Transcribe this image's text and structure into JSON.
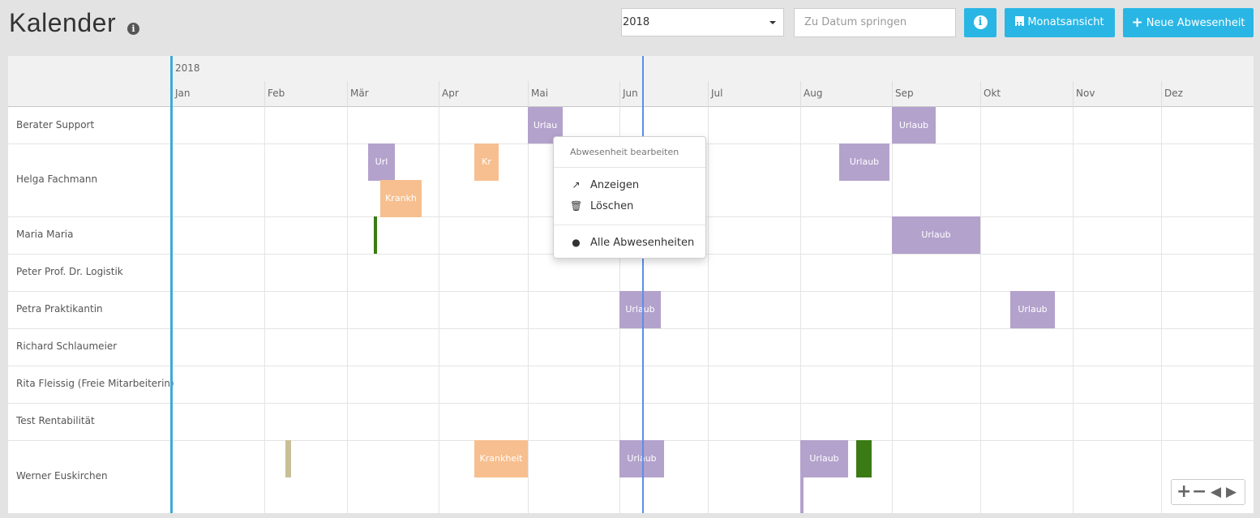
{
  "header": {
    "title": "Kalender",
    "year_select": "2018",
    "date_placeholder": "Zu Datum springen",
    "month_view_label": "Monatsansicht",
    "new_absence_label": "Neue Abwesenheit"
  },
  "calendar": {
    "year": "2018",
    "months": [
      "Jan",
      "Feb",
      "Mär",
      "Apr",
      "Mai",
      "Jun",
      "Jul",
      "Aug",
      "Sep",
      "Okt",
      "Nov",
      "Dez"
    ],
    "rows": [
      "Berater Support",
      "Helga Fachmann",
      "Maria Maria",
      "Peter Prof. Dr. Logistik",
      "Petra Praktikantin",
      "Richard Schlaumeier",
      "Rita Fleissig (Freie Mitarbeiterin)",
      "Test Rentabilität",
      "Werner Euskirchen"
    ],
    "events": [
      {
        "label": "Urlau"
      },
      {
        "label": "Urlaub"
      },
      {
        "label": "Url"
      },
      {
        "label": "Kr"
      },
      {
        "label": "Krankh"
      },
      {
        "label": "Urlaub"
      },
      {
        "label": "Urlaub"
      },
      {
        "label": "Urlaub"
      },
      {
        "label": "Urlaub"
      },
      {
        "label": "Krankheit"
      },
      {
        "label": "Urlaub"
      },
      {
        "label": "Urlaub"
      }
    ]
  },
  "context_menu": {
    "header": "Abwesenheit bearbeiten",
    "show": "Anzeigen",
    "delete": "Löschen",
    "all_absences": "Alle Abwesenheiten"
  },
  "zoom": {
    "zoom_in": "+",
    "zoom_out": "−",
    "prev": "◀",
    "next": "▶"
  },
  "colors": {
    "accent": "#29b6e5",
    "vacation": "#b3a2cc",
    "sickness": "#f7bf8f",
    "other": "#3b7a14",
    "today_line": "#5b8fea"
  }
}
